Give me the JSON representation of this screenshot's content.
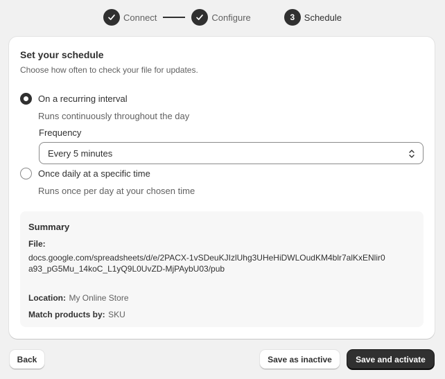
{
  "stepper": {
    "steps": [
      {
        "label": "Connect",
        "state": "done"
      },
      {
        "label": "Configure",
        "state": "done"
      },
      {
        "label": "Schedule",
        "number": "3",
        "state": "active"
      }
    ]
  },
  "card": {
    "title": "Set your schedule",
    "subtitle": "Choose how often to check your file for updates.",
    "options": [
      {
        "label": "On a recurring interval",
        "help": "Runs continuously throughout the day",
        "checked": true
      },
      {
        "label": "Once daily at a specific time",
        "help": "Runs once per day at your chosen time",
        "checked": false
      }
    ],
    "frequency": {
      "label": "Frequency",
      "value": "Every 5 minutes"
    }
  },
  "summary": {
    "title": "Summary",
    "file_label": "File:",
    "file_value": "docs.google.com/spreadsheets/d/e/2PACX-1vSDeuKJIzlUhg3UHeHiDWLOudKM4blr7alKxENlir0a93_pG5Mu_14koC_L1yQ9L0UvZD-MjPAybU03/pub",
    "location_label": "Location:",
    "location_value": "My Online Store",
    "match_label": "Match products by:",
    "match_value": "SKU"
  },
  "footer": {
    "back_label": "Back",
    "save_inactive_label": "Save as inactive",
    "save_activate_label": "Save and activate"
  },
  "colors": {
    "primary": "#303030",
    "background": "#f1f1f1",
    "card": "#ffffff",
    "summary_bg": "#f7f7f7"
  }
}
